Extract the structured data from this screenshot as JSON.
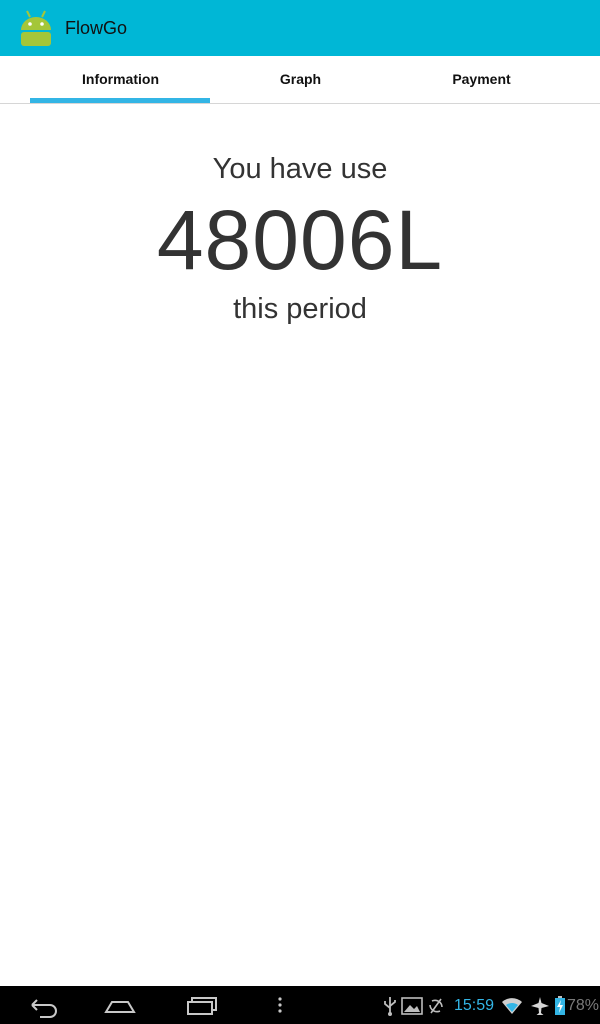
{
  "app": {
    "title": "FlowGo",
    "icon": "android-robot-icon"
  },
  "tabs": [
    {
      "label": "Information",
      "selected": true
    },
    {
      "label": "Graph",
      "selected": false
    },
    {
      "label": "Payment",
      "selected": false
    }
  ],
  "usage": {
    "prefix": "You have use",
    "value": "48006L",
    "suffix": "this period"
  },
  "system_bar": {
    "nav": [
      "back-icon",
      "home-icon",
      "recent-apps-icon",
      "overflow-menu-icon"
    ],
    "status_icons": [
      "usb-icon",
      "gallery-icon",
      "no-sync-icon",
      "wifi-icon",
      "airplane-mode-icon",
      "battery-icon"
    ],
    "time": "15:59",
    "battery": "78%"
  },
  "colors": {
    "action_bar": "#00b7d6",
    "tab_indicator": "#33b5e5",
    "clock": "#33b5e5"
  }
}
